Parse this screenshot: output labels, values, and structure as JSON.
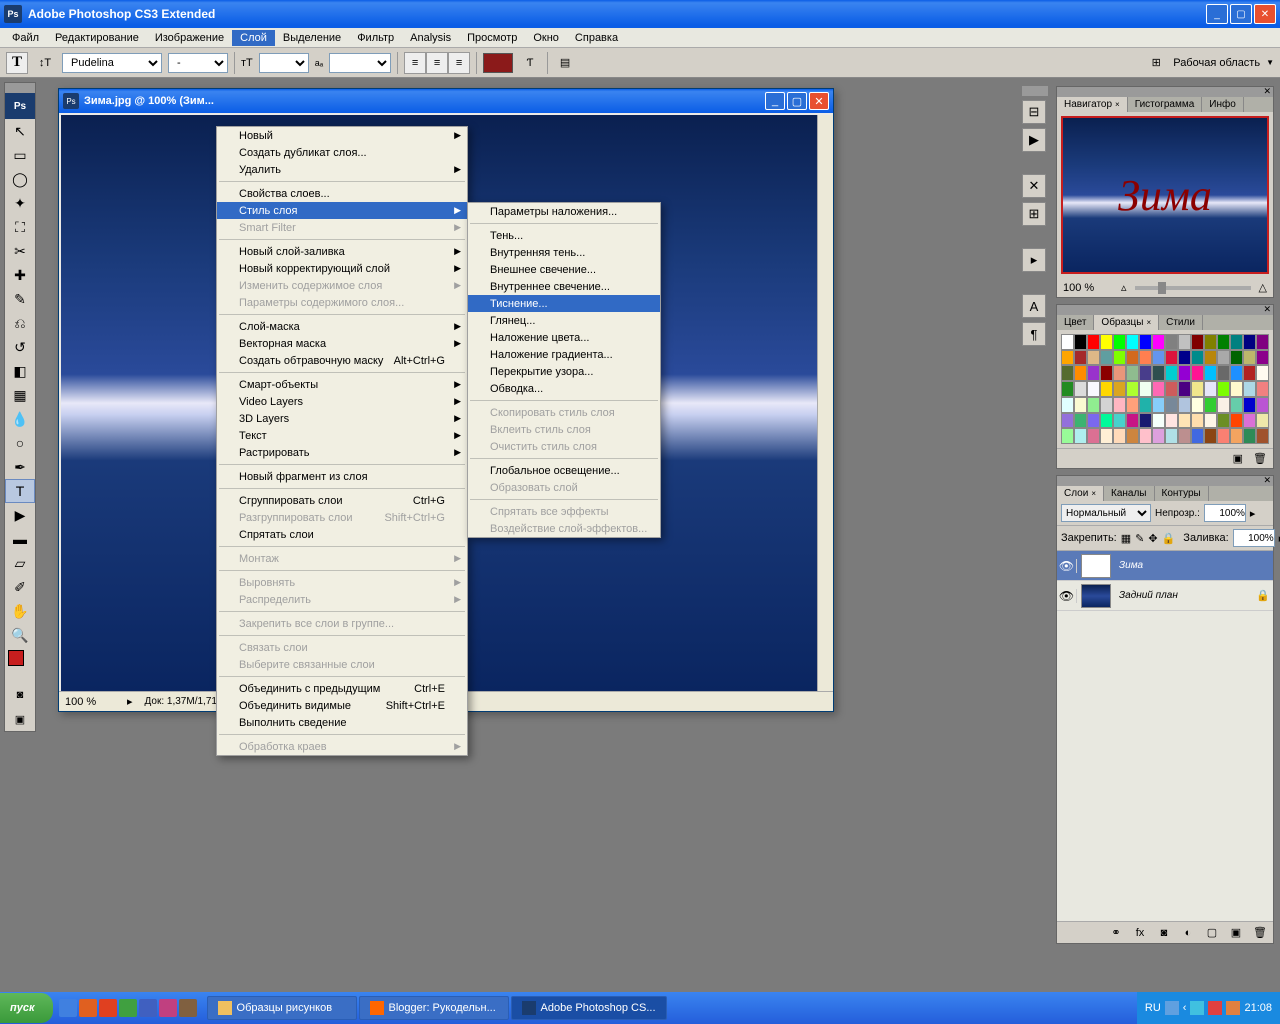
{
  "app": {
    "title": "Adobe Photoshop CS3 Extended",
    "logo": "Ps"
  },
  "menubar": [
    "Файл",
    "Редактирование",
    "Изображение",
    "Слой",
    "Выделение",
    "Фильтр",
    "Analysis",
    "Просмотр",
    "Окно",
    "Справка"
  ],
  "menubar_active_index": 3,
  "options_bar": {
    "font": "Pudelina",
    "color": "#8b1a1a",
    "workspace_label": "Рабочая область"
  },
  "document": {
    "title": "Зима.jpg @ 100% (Зим...",
    "zoom": "100 %",
    "doc_info": "Док: 1,37M/1,71M"
  },
  "menu_layer": {
    "items": [
      {
        "label": "Новый",
        "arrow": true
      },
      {
        "label": "Создать дубликат слоя..."
      },
      {
        "label": "Удалить",
        "arrow": true
      },
      {
        "sep": true
      },
      {
        "label": "Свойства слоев..."
      },
      {
        "label": "Стиль слоя",
        "arrow": true,
        "highlight": true
      },
      {
        "label": "Smart Filter",
        "arrow": true,
        "disabled": true
      },
      {
        "sep": true
      },
      {
        "label": "Новый слой-заливка",
        "arrow": true
      },
      {
        "label": "Новый корректирующий слой",
        "arrow": true
      },
      {
        "label": "Изменить содержимое слоя",
        "arrow": true,
        "disabled": true
      },
      {
        "label": "Параметры содержимого слоя...",
        "disabled": true
      },
      {
        "sep": true
      },
      {
        "label": "Слой-маска",
        "arrow": true
      },
      {
        "label": "Векторная маска",
        "arrow": true
      },
      {
        "label": "Создать обтравочную маску",
        "shortcut": "Alt+Ctrl+G"
      },
      {
        "sep": true
      },
      {
        "label": "Смарт-объекты",
        "arrow": true
      },
      {
        "label": "Video Layers",
        "arrow": true
      },
      {
        "label": "3D Layers",
        "arrow": true
      },
      {
        "label": "Текст",
        "arrow": true
      },
      {
        "label": "Растрировать",
        "arrow": true
      },
      {
        "sep": true
      },
      {
        "label": "Новый фрагмент из слоя"
      },
      {
        "sep": true
      },
      {
        "label": "Сгруппировать слои",
        "shortcut": "Ctrl+G"
      },
      {
        "label": "Разгруппировать слои",
        "shortcut": "Shift+Ctrl+G",
        "disabled": true
      },
      {
        "label": "Спрятать слои"
      },
      {
        "sep": true
      },
      {
        "label": "Монтаж",
        "arrow": true,
        "disabled": true
      },
      {
        "sep": true
      },
      {
        "label": "Выровнять",
        "arrow": true,
        "disabled": true
      },
      {
        "label": "Распределить",
        "arrow": true,
        "disabled": true
      },
      {
        "sep": true
      },
      {
        "label": "Закрепить все слои в группе...",
        "disabled": true
      },
      {
        "sep": true
      },
      {
        "label": "Связать слои",
        "disabled": true
      },
      {
        "label": "Выберите связанные слои",
        "disabled": true
      },
      {
        "sep": true
      },
      {
        "label": "Объединить с предыдущим",
        "shortcut": "Ctrl+E"
      },
      {
        "label": "Объединить видимые",
        "shortcut": "Shift+Ctrl+E"
      },
      {
        "label": "Выполнить сведение"
      },
      {
        "sep": true
      },
      {
        "label": "Обработка краев",
        "arrow": true,
        "disabled": true
      }
    ]
  },
  "menu_style": {
    "items": [
      {
        "label": "Параметры наложения..."
      },
      {
        "sep": true
      },
      {
        "label": "Тень..."
      },
      {
        "label": "Внутренняя тень..."
      },
      {
        "label": "Внешнее свечение..."
      },
      {
        "label": "Внутреннее свечение..."
      },
      {
        "label": "Тиснение...",
        "highlight": true
      },
      {
        "label": "Глянец..."
      },
      {
        "label": "Наложение цвета..."
      },
      {
        "label": "Наложение градиента..."
      },
      {
        "label": "Перекрытие узора..."
      },
      {
        "label": "Обводка..."
      },
      {
        "sep": true
      },
      {
        "label": "Скопировать стиль слоя",
        "disabled": true
      },
      {
        "label": "Вклеить стиль слоя",
        "disabled": true
      },
      {
        "label": "Очистить стиль слоя",
        "disabled": true
      },
      {
        "sep": true
      },
      {
        "label": "Глобальное освещение..."
      },
      {
        "label": "Образовать слой",
        "disabled": true
      },
      {
        "sep": true
      },
      {
        "label": "Спрятать все эффекты",
        "disabled": true
      },
      {
        "label": "Воздействие слой-эффектов...",
        "disabled": true
      }
    ]
  },
  "navigator": {
    "tabs": [
      "Навигатор",
      "Гистограмма",
      "Инфо"
    ],
    "active_tab": 0,
    "zoom": "100 %",
    "text": "Зима"
  },
  "swatches": {
    "tabs": [
      "Цвет",
      "Образцы",
      "Стили"
    ],
    "active_tab": 1,
    "colors": [
      "#ffffff",
      "#000000",
      "#ff0000",
      "#ffff00",
      "#00ff00",
      "#00ffff",
      "#0000ff",
      "#ff00ff",
      "#808080",
      "#c0c0c0",
      "#800000",
      "#808000",
      "#008000",
      "#008080",
      "#000080",
      "#800080",
      "#ffa500",
      "#a52a2a",
      "#deb887",
      "#5f9ea0",
      "#7fff00",
      "#d2691e",
      "#ff7f50",
      "#6495ed",
      "#dc143c",
      "#00008b",
      "#008b8b",
      "#b8860b",
      "#a9a9a9",
      "#006400",
      "#bdb76b",
      "#8b008b",
      "#556b2f",
      "#ff8c00",
      "#9932cc",
      "#8b0000",
      "#e9967a",
      "#8fbc8f",
      "#483d8b",
      "#2f4f4f",
      "#00ced1",
      "#9400d3",
      "#ff1493",
      "#00bfff",
      "#696969",
      "#1e90ff",
      "#b22222",
      "#fffaf0",
      "#228b22",
      "#dcdcdc",
      "#f8f8ff",
      "#ffd700",
      "#daa520",
      "#adff2f",
      "#f0fff0",
      "#ff69b4",
      "#cd5c5c",
      "#4b0082",
      "#f0e68c",
      "#e6e6fa",
      "#7cfc00",
      "#fffacd",
      "#add8e6",
      "#f08080",
      "#e0ffff",
      "#fafad2",
      "#90ee90",
      "#d3d3d3",
      "#ffb6c1",
      "#ffa07a",
      "#20b2aa",
      "#87cefa",
      "#778899",
      "#b0c4de",
      "#ffffe0",
      "#32cd32",
      "#faf0e6",
      "#66cdaa",
      "#0000cd",
      "#ba55d3",
      "#9370db",
      "#3cb371",
      "#7b68ee",
      "#00fa9a",
      "#48d1cc",
      "#c71585",
      "#191970",
      "#f5fffa",
      "#ffe4e1",
      "#ffe4b5",
      "#ffdead",
      "#fdf5e6",
      "#6b8e23",
      "#ff4500",
      "#da70d6",
      "#eee8aa",
      "#98fb98",
      "#afeeee",
      "#db7093",
      "#ffefd5",
      "#ffdab9",
      "#cd853f",
      "#ffc0cb",
      "#dda0dd",
      "#b0e0e6",
      "#bc8f8f",
      "#4169e1",
      "#8b4513",
      "#fa8072",
      "#f4a460",
      "#2e8b57",
      "#a0522d"
    ]
  },
  "layers": {
    "tabs": [
      "Слои",
      "Каналы",
      "Контуры"
    ],
    "active_tab": 0,
    "blend_mode": "Нормальный",
    "opacity_label": "Непрозр.:",
    "opacity": "100%",
    "lock_label": "Закрепить:",
    "fill_label": "Заливка:",
    "fill": "100%",
    "items": [
      {
        "name": "Зима",
        "type": "T",
        "selected": true
      },
      {
        "name": "Задний план",
        "type": "img",
        "locked": true
      }
    ]
  },
  "taskbar": {
    "start": "пуск",
    "tasks": [
      {
        "label": "Образцы рисунков",
        "icon_color": "#f0c060"
      },
      {
        "label": "Blogger: Рукодельн...",
        "icon_color": "#ff6600"
      },
      {
        "label": "Adobe Photoshop CS...",
        "icon_color": "#1a3c6e",
        "active": true
      }
    ],
    "lang": "RU",
    "time": "21:08"
  }
}
